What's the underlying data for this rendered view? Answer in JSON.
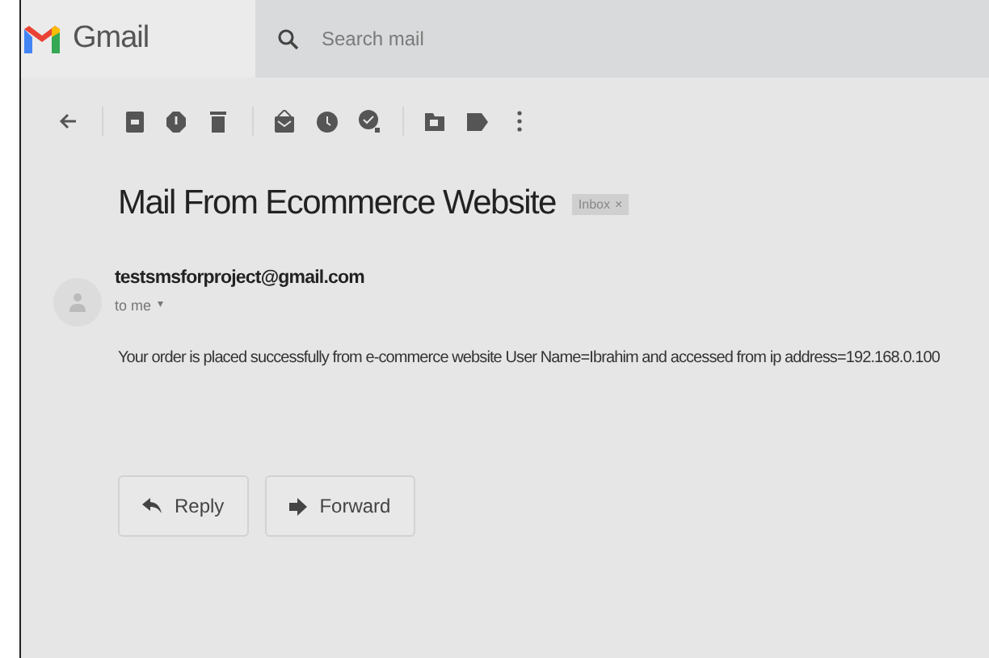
{
  "app": {
    "name": "Gmail"
  },
  "search": {
    "placeholder": "Search mail"
  },
  "toolbar": {
    "groups": [
      {
        "buttons": [
          {
            "kind": "back"
          }
        ]
      },
      {
        "buttons": [
          {
            "kind": "archive"
          },
          {
            "kind": "report"
          },
          {
            "kind": "delete"
          }
        ]
      },
      {
        "buttons": [
          {
            "kind": "mark"
          },
          {
            "kind": "snooze"
          },
          {
            "kind": "task"
          }
        ]
      },
      {
        "buttons": [
          {
            "kind": "move"
          },
          {
            "kind": "label"
          },
          {
            "kind": "more"
          }
        ]
      }
    ]
  },
  "message": {
    "subject": "Mail From Ecommerce Website",
    "label": {
      "text": "Inbox",
      "close": "×"
    },
    "sender": "testsmsforproject@gmail.com",
    "recipient": "to me",
    "recipient_caret": "▾",
    "body": "Your order is placed successfully from e-commerce website User Name=Ibrahim and accessed from ip address=192.168.0.100"
  },
  "actions": [
    {
      "kind": "reply",
      "label": "Reply"
    },
    {
      "kind": "forward",
      "label": "Forward"
    }
  ]
}
